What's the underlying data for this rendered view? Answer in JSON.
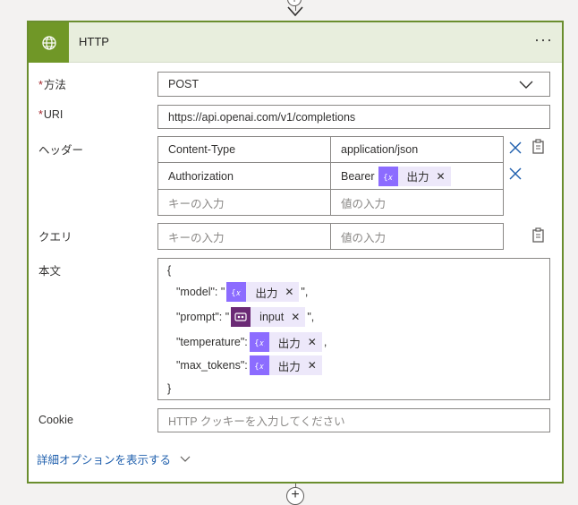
{
  "action": {
    "title": "HTTP",
    "more_label": "···"
  },
  "fields": {
    "required_mark": "*",
    "method": {
      "label": "方法",
      "value": "POST"
    },
    "uri": {
      "label": "URI",
      "value": "https://api.openai.com/v1/completions"
    },
    "headers": {
      "label": "ヘッダー",
      "rows": [
        {
          "key": "Content-Type",
          "value": "application/json"
        },
        {
          "key": "Authorization",
          "value_prefix": "Bearer",
          "token": "出力"
        }
      ],
      "key_placeholder": "キーの入力",
      "value_placeholder": "値の入力"
    },
    "queries": {
      "label": "クエリ",
      "key_placeholder": "キーの入力",
      "value_placeholder": "値の入力"
    },
    "body": {
      "label": "本文",
      "open_brace": "{",
      "close_brace": "}",
      "lines": [
        {
          "key": "\"model\": \"",
          "token": "出力",
          "suffix": "\","
        },
        {
          "key": "\"prompt\": \"",
          "token": "input",
          "suffix": "\","
        },
        {
          "key": "\"temperature\":",
          "token": "出力",
          "suffix": ","
        },
        {
          "key": "\"max_tokens\":",
          "token": "出力",
          "suffix": ""
        }
      ]
    },
    "cookie": {
      "label": "Cookie",
      "placeholder": "HTTP クッキーを入力してください"
    }
  },
  "advanced_options": {
    "label": "詳細オプションを表示する"
  },
  "connector": {
    "add_symbol": "+"
  },
  "colors": {
    "accent_green": "#709727",
    "border_green": "#6a8e2e",
    "token_purple": "#8c6cff",
    "token_dark": "#6b2a75",
    "link_blue": "#1f5fad",
    "required_red": "#a4262c"
  },
  "icons": {
    "header": "globe-icon",
    "dropdown": "chevron-down-icon",
    "remove": "close-icon",
    "clip": "clipboard-icon",
    "token": "expression-icon",
    "token_input": "trigger-input-icon"
  }
}
